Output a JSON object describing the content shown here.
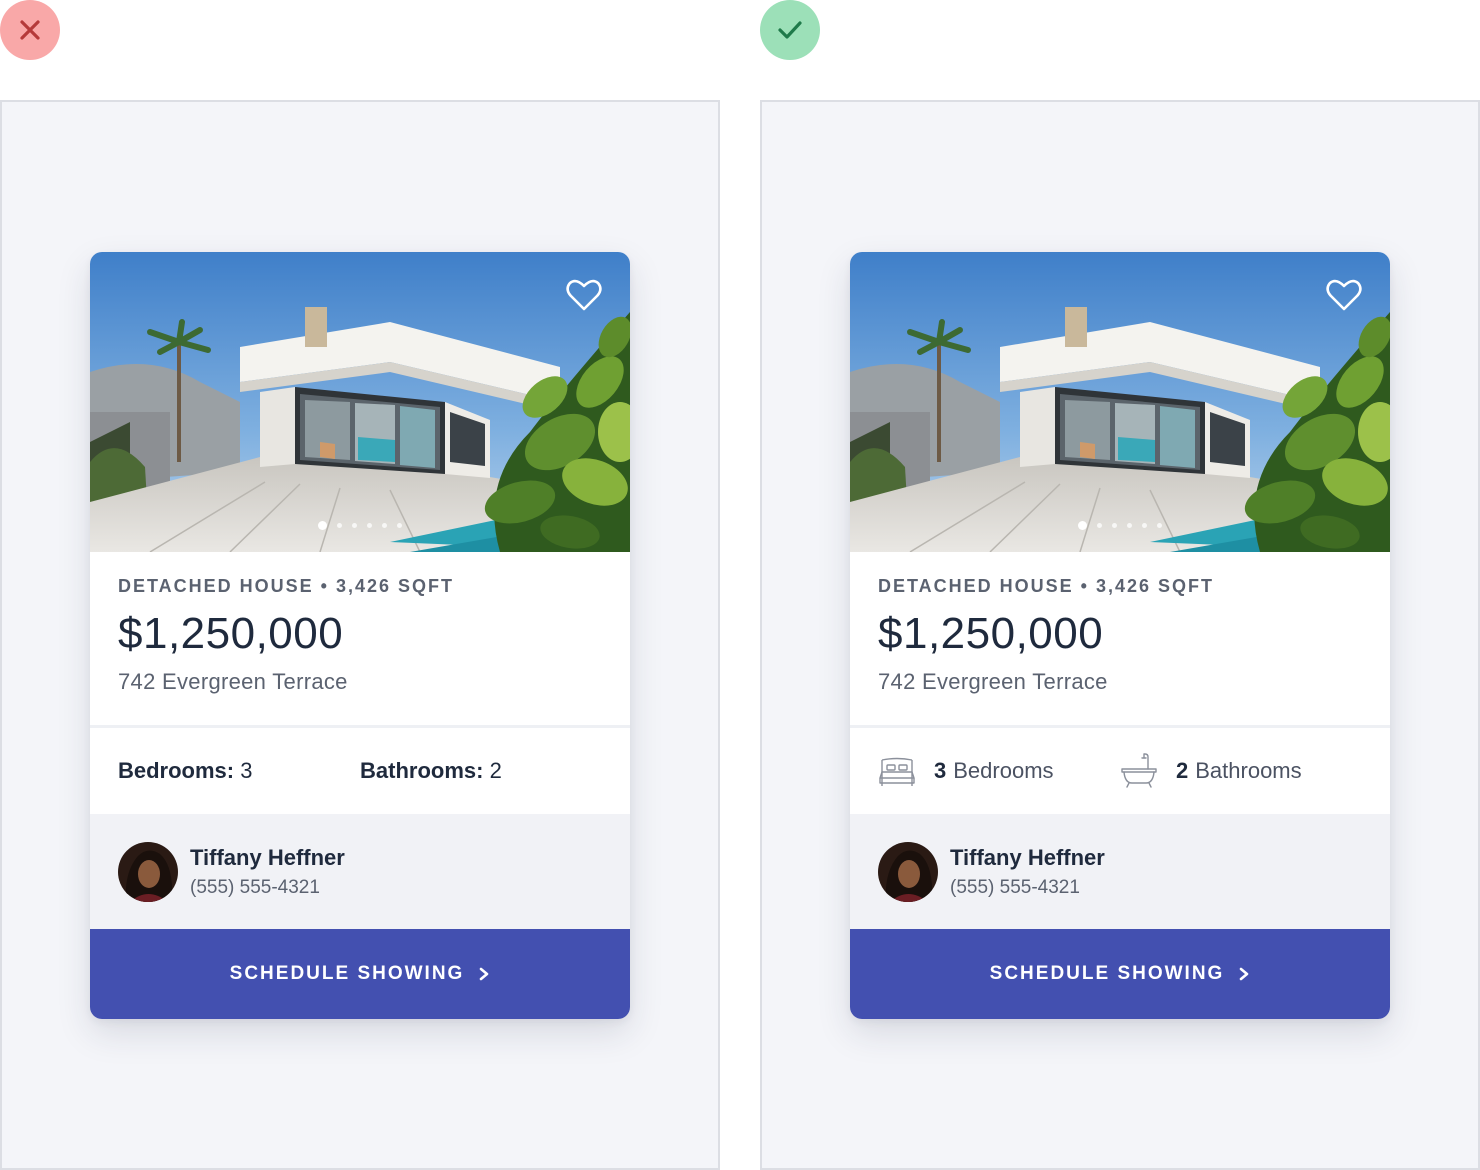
{
  "comparison": {
    "bad_mark": "x-mark-icon",
    "good_mark": "check-mark-icon",
    "colors": {
      "bad_badge": "#f9a8a8",
      "bad_mark": "#b53a3a",
      "good_badge": "#9ce0b8",
      "good_mark": "#1f7a4a",
      "cta": "#4350b0"
    }
  },
  "listing": {
    "meta": "DETACHED HOUSE • 3,426 SQFT",
    "price": "$1,250,000",
    "address": "742 Evergreen Terrace",
    "photo_count": 6,
    "photo_active": 1,
    "favorite_icon": "heart-icon"
  },
  "features_bad": {
    "bedrooms_label": "Bedrooms:",
    "bedrooms_value": "3",
    "bathrooms_label": "Bathrooms:",
    "bathrooms_value": "2"
  },
  "features_good": {
    "bedrooms_icon": "bed-icon",
    "bedrooms_value": "3",
    "bedrooms_word": "Bedrooms",
    "bathrooms_icon": "bathtub-icon",
    "bathrooms_value": "2",
    "bathrooms_word": "Bathrooms"
  },
  "agent": {
    "name": "Tiffany Heffner",
    "phone": "(555) 555-4321"
  },
  "cta": {
    "label": "SCHEDULE SHOWING",
    "icon": "chevron-right-icon"
  }
}
